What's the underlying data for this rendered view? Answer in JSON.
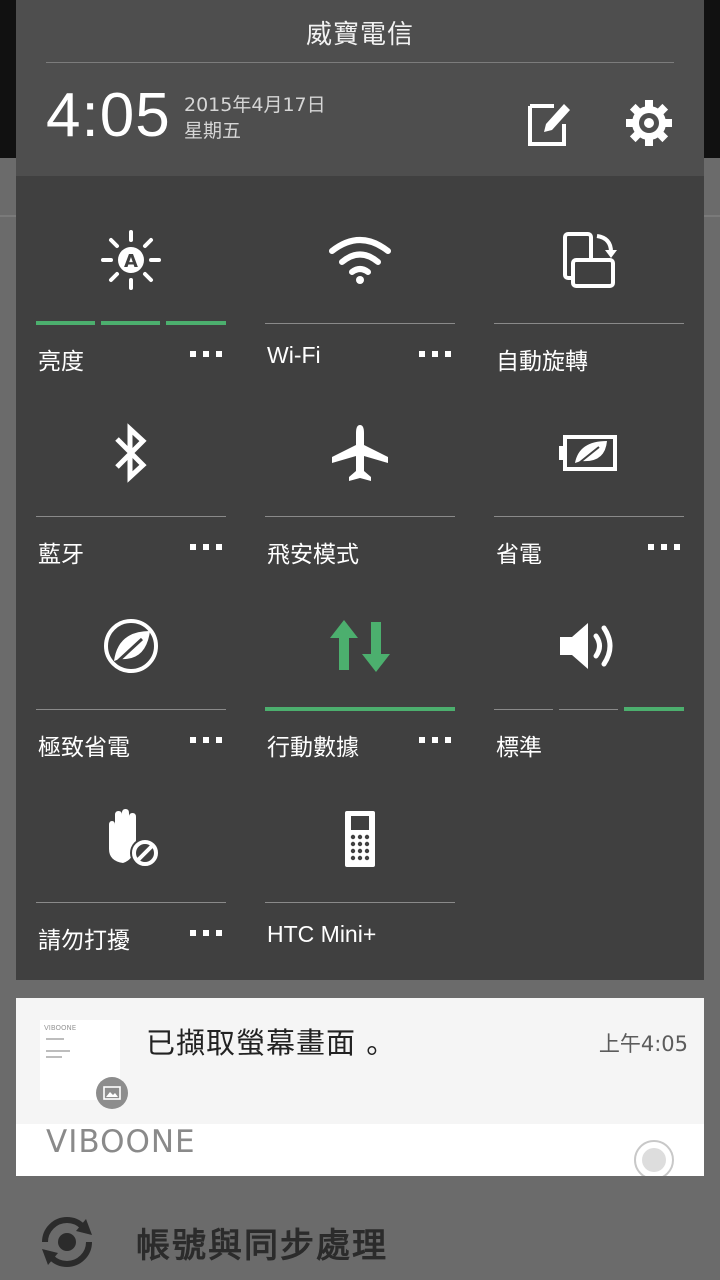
{
  "status": {
    "carrier": "威寶電信",
    "time": "4:05",
    "date_line": "2015年4月17日",
    "weekday": "星期五"
  },
  "header_icons": {
    "edit": "edit-icon",
    "settings": "gear-icon"
  },
  "quick_settings": [
    {
      "label": "亮度",
      "icon": "brightness-auto-icon",
      "has_more": true,
      "level_segments": 3,
      "level_on": 3
    },
    {
      "label": "Wi-Fi",
      "icon": "wifi-icon",
      "has_more": true
    },
    {
      "label": "自動旋轉",
      "icon": "auto-rotate-icon",
      "has_more": false
    },
    {
      "label": "藍牙",
      "icon": "bluetooth-icon",
      "has_more": true
    },
    {
      "label": "飛安模式",
      "icon": "airplane-icon",
      "has_more": false
    },
    {
      "label": "省電",
      "icon": "power-saver-icon",
      "has_more": true
    },
    {
      "label": "極致省電",
      "icon": "extreme-power-saver-icon",
      "has_more": true
    },
    {
      "label": "行動數據",
      "icon": "mobile-data-icon",
      "has_more": true,
      "active": true
    },
    {
      "label": "標準",
      "icon": "volume-icon",
      "has_more": false,
      "level_segments": 3,
      "level_on": 1
    },
    {
      "label": "請勿打擾",
      "icon": "do-not-disturb-icon",
      "has_more": true
    },
    {
      "label": "HTC Mini+",
      "icon": "htc-mini-icon",
      "has_more": false
    }
  ],
  "notification": {
    "title": "已擷取螢幕畫面 。",
    "time": "上午4:05",
    "thumb_icon": "screenshot-icon",
    "thumb_text": "VIBOONE"
  },
  "background": {
    "app_name": "VIBOONE",
    "row_label": "帳號與同步處理",
    "row_icon": "sync-icon"
  },
  "colors": {
    "accent": "#4caf6e",
    "shade": "#404040",
    "header": "#4e4e4e"
  }
}
